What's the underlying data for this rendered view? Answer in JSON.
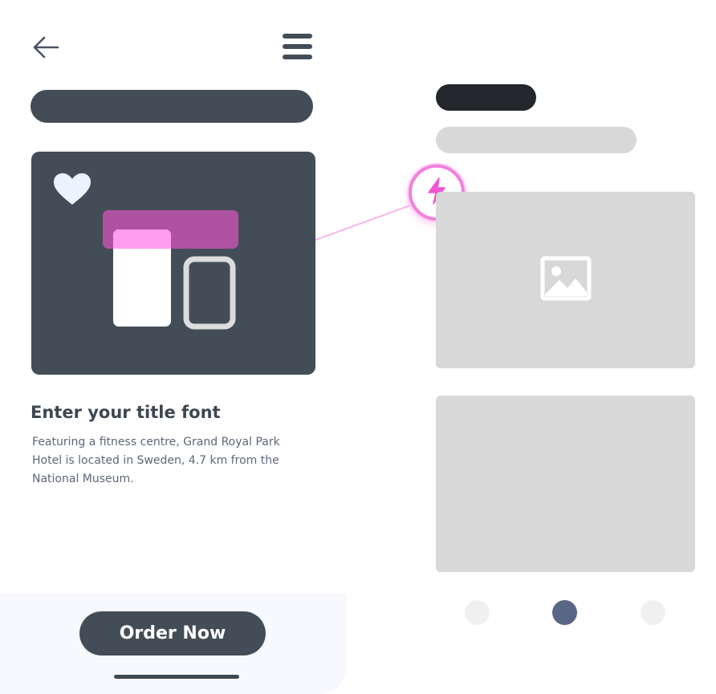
{
  "card": {
    "title": "Enter your title font",
    "description": "Featuring a fitness centre, Grand Royal Park Hotel is located in Sweden, 4.7 km from the National Museum."
  },
  "footer": {
    "order_button_label": "Order Now"
  },
  "pagination": {
    "active_index": 1,
    "count": 3
  },
  "icons": {
    "back": "arrow-left-icon",
    "menu": "hamburger-menu-icon",
    "favorite": "heart-icon",
    "badge": "lightning-icon",
    "placeholder": "image-placeholder-icon"
  },
  "colors": {
    "dark_slate": "#434d57",
    "accent_pink": "#f27fdc",
    "accent_magenta": "#b052a3",
    "wireframe_gray": "#d8d8d8",
    "active_dot": "#5a6686"
  }
}
